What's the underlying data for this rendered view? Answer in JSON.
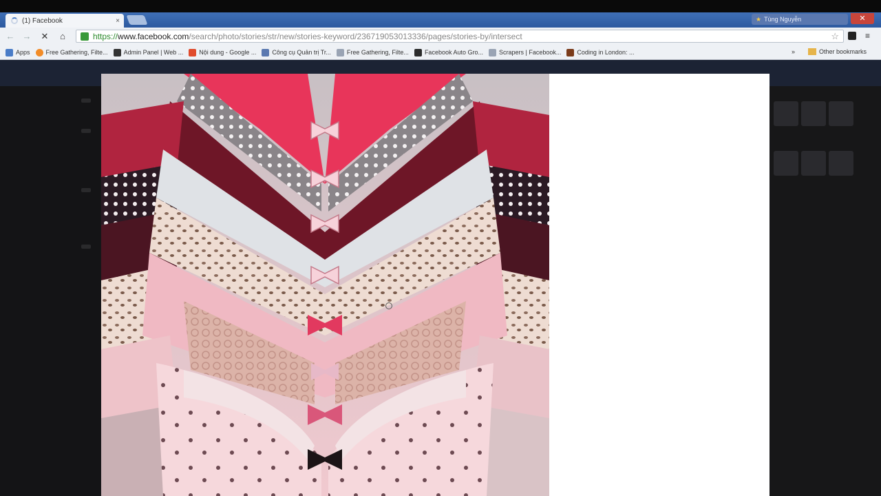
{
  "browser": {
    "tab": {
      "title": "(1) Facebook",
      "close": "×"
    },
    "profile": {
      "name": "Tùng Nguyễn"
    },
    "window_close": "✕",
    "toolbar": {
      "back": "←",
      "forward": "→",
      "stop": "✕",
      "home": "⌂",
      "star": "☆",
      "menu": "≡"
    },
    "url": {
      "scheme": "https://",
      "host": "www.facebook.com",
      "path": "/search/photo/stories/str/new/stories-keyword/236719053013336/pages/stories-by/intersect"
    },
    "bookmarks": [
      {
        "label": "Apps",
        "icon": "apps-grid-icon",
        "color": "#4a7cc7"
      },
      {
        "label": "Free Gathering, Filte...",
        "icon": "orange-circle-icon",
        "color": "#f28c28"
      },
      {
        "label": "Admin Panel | Web ...",
        "icon": "tools-icon",
        "color": "#333333"
      },
      {
        "label": "Nội dung - Google ...",
        "icon": "google-ads-icon",
        "color": "#e04b2c"
      },
      {
        "label": "Công cụ Quản trị Tr...",
        "icon": "webmaster-icon",
        "color": "#5a78b0"
      },
      {
        "label": "Free Gathering, Filte...",
        "icon": "page-icon",
        "color": "#9aa4b4"
      },
      {
        "label": "Facebook Auto Gro...",
        "icon": "bird-icon",
        "color": "#2b2b2b"
      },
      {
        "label": "Scrapers | Facebook...",
        "icon": "page-icon",
        "color": "#9aa4b4"
      },
      {
        "label": "Coding in London: ...",
        "icon": "coding-icon",
        "color": "#7a3b1a"
      }
    ],
    "bookmarks_more": "»",
    "other_bookmarks": "Other bookmarks"
  },
  "viewer": {
    "photo_icon": "lingerie-photo-icon",
    "side_panel": ""
  }
}
